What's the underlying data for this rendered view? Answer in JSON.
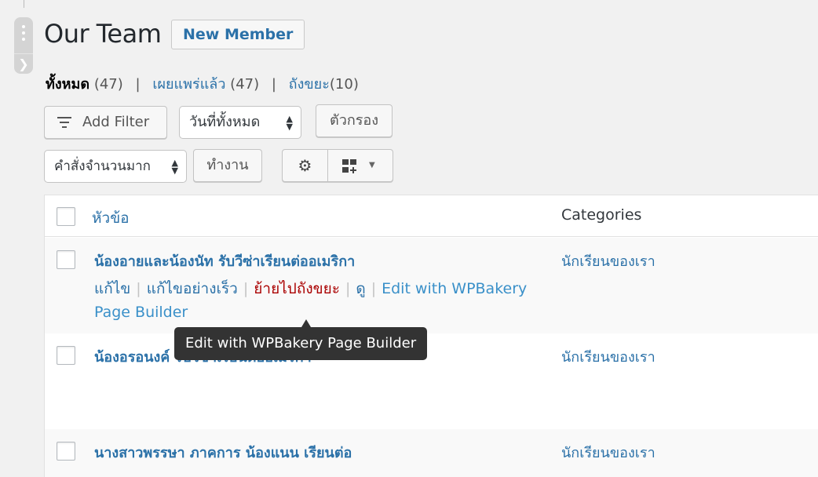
{
  "page": {
    "title": "Our Team",
    "new_button": "New Member"
  },
  "views": {
    "all_label": "ทั้งหมด",
    "all_count": "(47)",
    "published_label": "เผยแพร่แล้ว",
    "published_count": "(47)",
    "trash_label": "ถังขยะ",
    "trash_count": "(10)",
    "separator": "|"
  },
  "filters": {
    "add_filter_label": "Add Filter",
    "date_select": "วันที่ทั้งหมด",
    "filter_button": "ตัวกรอง",
    "bulk_select": "คำสั่งจำนวนมาก",
    "apply_button": "ทำงาน"
  },
  "table": {
    "headers": {
      "title": "หัวข้อ",
      "categories": "Categories"
    },
    "rows": [
      {
        "title": "น้องอายและน้องนัท รับวีซ่าเรียนต่ออเมริกา",
        "category": "นักเรียนของเรา"
      },
      {
        "title": "น้องอรอนงค์ รับวีซ่าเรียนต่ออเมริกา",
        "category": "นักเรียนของเรา"
      },
      {
        "title": "นางสาวพรรษา ภาคการ น้องแนน เรียนต่อ",
        "category": "นักเรียนของเรา"
      }
    ],
    "row_actions": {
      "edit": "แก้ไข",
      "quick_edit": "แก้ไขอย่างเร็ว",
      "trash": "ย้ายไปถังขยะ",
      "view": "ดู",
      "wpbakery_line1": "Edit with WPBakery",
      "wpbakery_line2": "Page Builder",
      "divider": "|"
    }
  },
  "tooltip": {
    "text": "Edit with WPBakery Page Builder"
  },
  "icons": {
    "filter": "filter-lines-icon",
    "gear": "gear-icon",
    "view": "grid-view-icon",
    "collapse": "chevron-right-icon"
  },
  "colors": {
    "link": "#2b71a8",
    "trash": "#aa0000",
    "tooltip_bg": "#333333"
  }
}
